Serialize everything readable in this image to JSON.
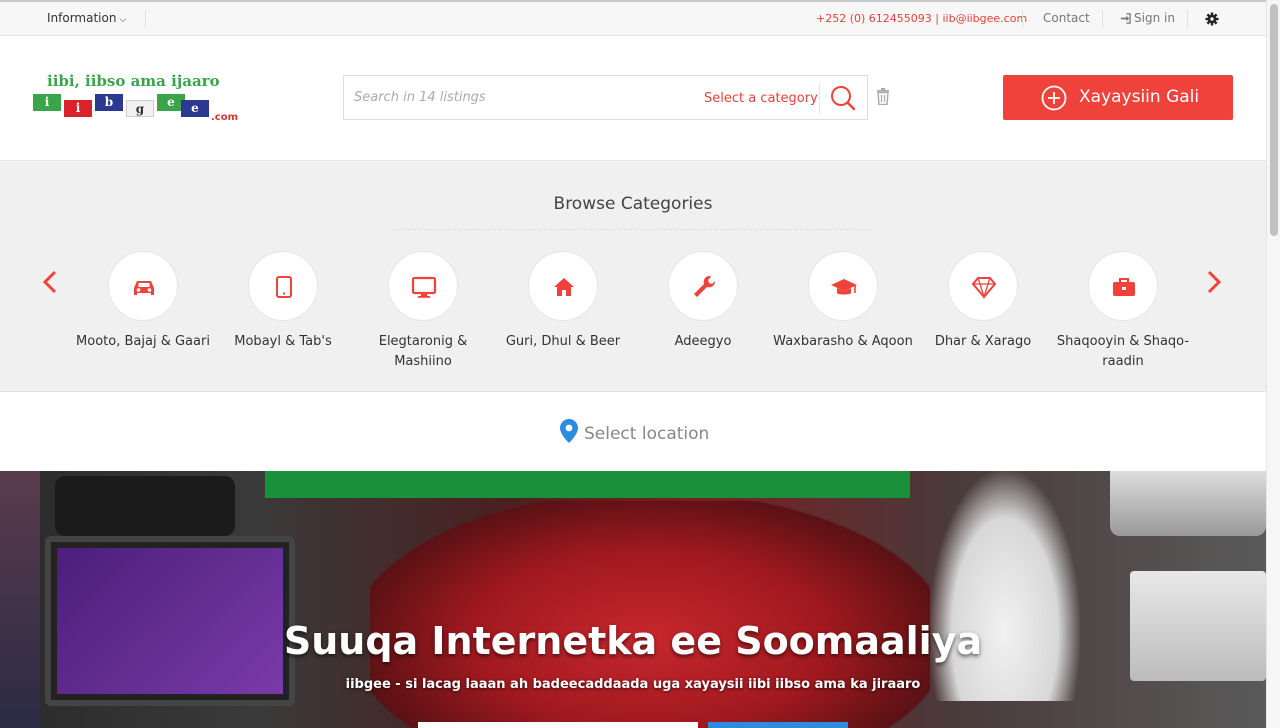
{
  "topbar": {
    "information": "Information",
    "phone_email": "+252 (0) 612455093 | iib@iibgee.com",
    "contact": "Contact",
    "sign_in": "Sign in"
  },
  "logo": {
    "tagline": "iibi, iibso ama ijaaro",
    "letters": [
      "i",
      "i",
      "b",
      "g",
      "e",
      "e"
    ],
    "dotcom": ".com"
  },
  "search": {
    "placeholder": "Search in 14 listings",
    "category": "Select a category"
  },
  "post_ad": {
    "label": "Xayaysiin Gali"
  },
  "categories": {
    "title": "Browse Categories",
    "items": [
      {
        "label": "Mooto, Bajaj & Gaari",
        "icon": "car-icon"
      },
      {
        "label": "Mobayl & Tab's",
        "icon": "tablet-icon"
      },
      {
        "label": "Elegtaronig & Mashiino",
        "icon": "monitor-icon"
      },
      {
        "label": "Guri, Dhul & Beer",
        "icon": "home-icon"
      },
      {
        "label": "Adeegyo",
        "icon": "wrench-icon"
      },
      {
        "label": "Waxbarasho & Aqoon",
        "icon": "graduation-cap-icon"
      },
      {
        "label": "Dhar & Xarago",
        "icon": "diamond-icon"
      },
      {
        "label": "Shaqooyin & Shaqo-raadin",
        "icon": "briefcase-icon"
      }
    ]
  },
  "location": {
    "label": "Select location"
  },
  "hero": {
    "headline": "Suuqa Internetka ee Soomaaliya",
    "subline": "iibgee - si lacag laaan ah badeecaddaada uga xayaysii iibi iibso ama ka jiraaro"
  },
  "colors": {
    "accent": "#ef423b",
    "green": "#1a8f3c",
    "location_pin": "#2e8ce0"
  }
}
